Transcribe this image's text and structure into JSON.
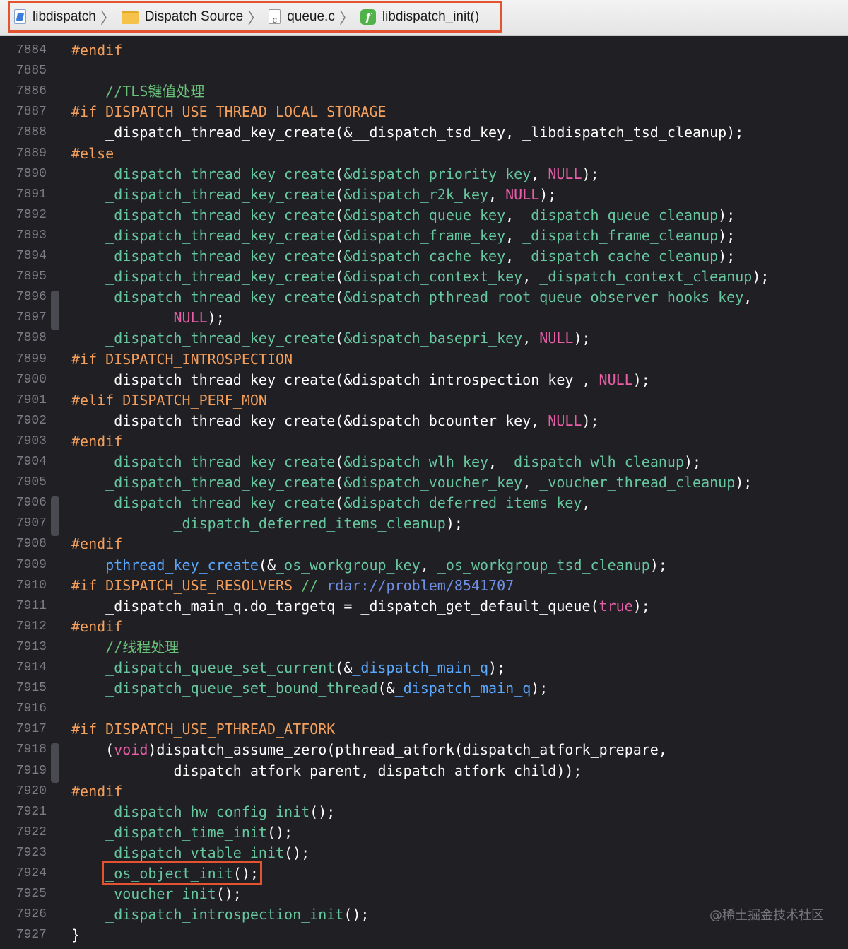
{
  "breadcrumb": {
    "items": [
      {
        "label": "libdispatch",
        "icon": "project-icon"
      },
      {
        "label": "Dispatch Source",
        "icon": "folder-icon"
      },
      {
        "label": "queue.c",
        "icon": "c-file-icon"
      },
      {
        "label": "libdispatch_init()",
        "icon": "function-icon"
      }
    ],
    "separator": "〉",
    "highlight_color": "#e4532f"
  },
  "code_lines": [
    {
      "n": "7884",
      "html": "<span class=\"pp\">#endif</span>"
    },
    {
      "n": "7885",
      "html": ""
    },
    {
      "n": "7886",
      "html": "    <span class=\"cm\">//TLS键值处理</span>"
    },
    {
      "n": "7887",
      "html": "<span class=\"pp\">#if DISPATCH_USE_THREAD_LOCAL_STORAGE</span>"
    },
    {
      "n": "7888",
      "html": "    _dispatch_thread_key_create(&__dispatch_tsd_key, _libdispatch_tsd_cleanup);"
    },
    {
      "n": "7889",
      "html": "<span class=\"pp\">#else</span>"
    },
    {
      "n": "7890",
      "html": "    <span class=\"fn\">_dispatch_thread_key_create</span>(<span class=\"fn\">&dispatch_priority_key</span>, <span class=\"ns\">NULL</span>);"
    },
    {
      "n": "7891",
      "html": "    <span class=\"fn\">_dispatch_thread_key_create</span>(<span class=\"fn\">&dispatch_r2k_key</span>, <span class=\"ns\">NULL</span>);"
    },
    {
      "n": "7892",
      "html": "    <span class=\"fn\">_dispatch_thread_key_create</span>(<span class=\"fn\">&dispatch_queue_key</span>, <span class=\"fn\">_dispatch_queue_cleanup</span>);"
    },
    {
      "n": "7893",
      "html": "    <span class=\"fn\">_dispatch_thread_key_create</span>(<span class=\"fn\">&dispatch_frame_key</span>, <span class=\"fn\">_dispatch_frame_cleanup</span>);"
    },
    {
      "n": "7894",
      "html": "    <span class=\"fn\">_dispatch_thread_key_create</span>(<span class=\"fn\">&dispatch_cache_key</span>, <span class=\"fn\">_dispatch_cache_cleanup</span>);"
    },
    {
      "n": "7895",
      "html": "    <span class=\"fn\">_dispatch_thread_key_create</span>(<span class=\"fn\">&dispatch_context_key</span>, <span class=\"fn\">_dispatch_context_cleanup</span>);"
    },
    {
      "n": "7896",
      "html": "    <span class=\"fn\">_dispatch_thread_key_create</span>(<span class=\"fn\">&dispatch_pthread_root_queue_observer_hooks_key</span>,"
    },
    {
      "n": "7897",
      "html": "            <span class=\"ns\">NULL</span>);"
    },
    {
      "n": "7898",
      "html": "    <span class=\"fn\">_dispatch_thread_key_create</span>(<span class=\"fn\">&dispatch_basepri_key</span>, <span class=\"ns\">NULL</span>);"
    },
    {
      "n": "7899",
      "html": "<span class=\"pp\">#if DISPATCH_INTROSPECTION</span>"
    },
    {
      "n": "7900",
      "html": "    _dispatch_thread_key_create(&dispatch_introspection_key , <span class=\"ns\">NULL</span>);"
    },
    {
      "n": "7901",
      "html": "<span class=\"pp\">#elif DISPATCH_PERF_MON</span>"
    },
    {
      "n": "7902",
      "html": "    _dispatch_thread_key_create(&dispatch_bcounter_key, <span class=\"ns\">NULL</span>);"
    },
    {
      "n": "7903",
      "html": "<span class=\"pp\">#endif</span>"
    },
    {
      "n": "7904",
      "html": "    <span class=\"fn\">_dispatch_thread_key_create</span>(<span class=\"fn\">&dispatch_wlh_key</span>, <span class=\"fn\">_dispatch_wlh_cleanup</span>);"
    },
    {
      "n": "7905",
      "html": "    <span class=\"fn\">_dispatch_thread_key_create</span>(<span class=\"fn\">&dispatch_voucher_key</span>, <span class=\"fn\">_voucher_thread_cleanup</span>);"
    },
    {
      "n": "7906",
      "html": "    <span class=\"fn\">_dispatch_thread_key_create</span>(<span class=\"fn\">&dispatch_deferred_items_key</span>,"
    },
    {
      "n": "7907",
      "html": "            <span class=\"fn\">_dispatch_deferred_items_cleanup</span>);"
    },
    {
      "n": "7908",
      "html": "<span class=\"pp\">#endif</span>"
    },
    {
      "n": "7909",
      "html": "    <span class=\"bl\">pthread_key_create</span>(&<span class=\"fn\">_os_workgroup_key</span>, <span class=\"fn\">_os_workgroup_tsd_cleanup</span>);"
    },
    {
      "n": "7910",
      "html": "<span class=\"pp\">#if DISPATCH_USE_RESOLVERS</span> <span class=\"cm\">// </span><span class=\"rd\">rdar://problem/8541707</span>"
    },
    {
      "n": "7911",
      "html": "    _dispatch_main_q.do_targetq = _dispatch_get_default_queue(<span class=\"ns\">true</span>);"
    },
    {
      "n": "7912",
      "html": "<span class=\"pp\">#endif</span>"
    },
    {
      "n": "7913",
      "html": "    <span class=\"cm\">//线程处理</span>"
    },
    {
      "n": "7914",
      "html": "    <span class=\"fn\">_dispatch_queue_set_current</span>(&<span class=\"bl\">_dispatch_main_q</span>);"
    },
    {
      "n": "7915",
      "html": "    <span class=\"fn\">_dispatch_queue_set_bound_thread</span>(&<span class=\"bl\">_dispatch_main_q</span>);"
    },
    {
      "n": "7916",
      "html": ""
    },
    {
      "n": "7917",
      "html": "<span class=\"pp\">#if DISPATCH_USE_PTHREAD_ATFORK</span>"
    },
    {
      "n": "7918",
      "html": "    (<span class=\"ns\">void</span>)dispatch_assume_zero(pthread_atfork(dispatch_atfork_prepare,"
    },
    {
      "n": "7919",
      "html": "            dispatch_atfork_parent, dispatch_atfork_child));"
    },
    {
      "n": "7920",
      "html": "<span class=\"pp\">#endif</span>"
    },
    {
      "n": "7921",
      "html": "    <span class=\"fn\">_dispatch_hw_config_init</span>();"
    },
    {
      "n": "7922",
      "html": "    <span class=\"fn\">_dispatch_time_init</span>();"
    },
    {
      "n": "7923",
      "html": "    <span class=\"fn\">_dispatch_vtable_init</span>();"
    },
    {
      "n": "7924",
      "html": "    <span class=\"hl\"><span class=\"fn\">_os_object_init</span>();</span>"
    },
    {
      "n": "7925",
      "html": "    <span class=\"fn\">_voucher_init</span>();"
    },
    {
      "n": "7926",
      "html": "    <span class=\"fn\">_dispatch_introspection_init</span>();"
    },
    {
      "n": "7927",
      "html": "}"
    }
  ],
  "watermark": "@稀土掘金技术社区",
  "colors": {
    "background": "#1f1f24",
    "comment": "#6ac27a",
    "preprocessor": "#f4a05c",
    "function": "#67c79f",
    "keyword": "#e65fa7",
    "global": "#5ba8ff",
    "link": "#6f8fe6",
    "highlight_box": "#e4532f"
  }
}
